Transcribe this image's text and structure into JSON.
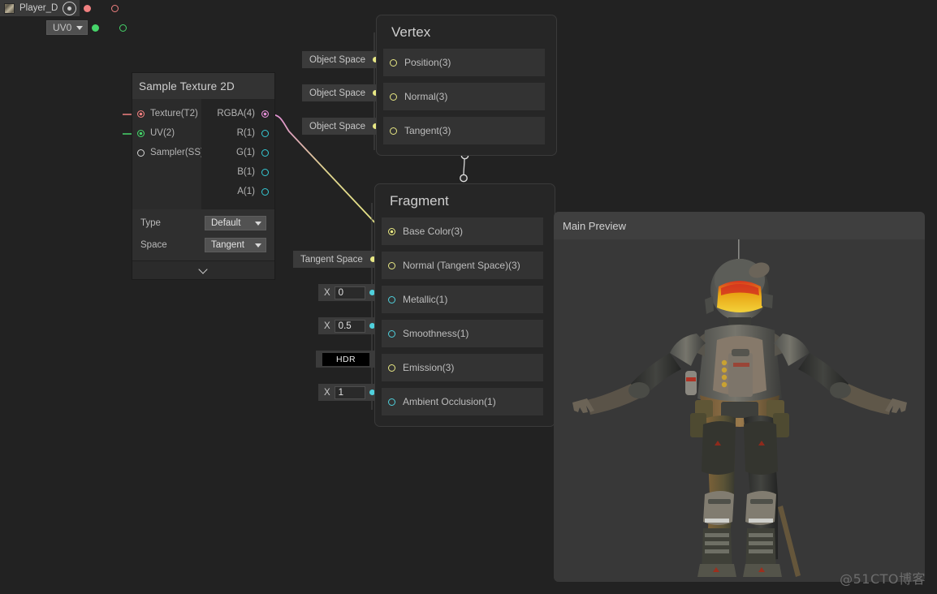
{
  "theme": {
    "background": "#222222",
    "node_body": "#2b2b2b",
    "node_header": "#333333",
    "master_body": "#262626",
    "row_bg": "#333333",
    "wire_vector": "#e8e884",
    "wire_float": "#4fd0dc",
    "wire_rgba": "#e58fd8",
    "wire_texture": "#f08080",
    "wire_uv": "#46d46a",
    "preview_bg": "#383838"
  },
  "property_node": {
    "name": "Player_D",
    "icon": "texture-thumbnail",
    "target_icon": "target-icon",
    "uv_dropdown": {
      "value": "UV0",
      "caret": "chevron-down-icon"
    }
  },
  "sample_texture_node": {
    "title": "Sample Texture 2D",
    "inputs": [
      {
        "label": "Texture(T2)",
        "port": "filled",
        "color": "#f08080",
        "connected": true
      },
      {
        "label": "UV(2)",
        "port": "filled",
        "color": "#46d46a",
        "connected": true
      },
      {
        "label": "Sampler(SS)",
        "port": "hollow",
        "color": "#d6d6d6",
        "connected": false
      }
    ],
    "outputs": [
      {
        "label": "RGBA(4)",
        "port": "filled",
        "color": "#e58fd8",
        "connected": true
      },
      {
        "label": "R(1)",
        "port": "hollow",
        "color": "#35c9d4",
        "connected": false
      },
      {
        "label": "G(1)",
        "port": "hollow",
        "color": "#35c9d4",
        "connected": false
      },
      {
        "label": "B(1)",
        "port": "hollow",
        "color": "#35c9d4",
        "connected": false
      },
      {
        "label": "A(1)",
        "port": "hollow",
        "color": "#35c9d4",
        "connected": false
      }
    ],
    "settings": [
      {
        "label": "Type",
        "value": "Default"
      },
      {
        "label": "Space",
        "value": "Tangent"
      }
    ],
    "expander_icon": "chevron-down-icon"
  },
  "vertex_node": {
    "title": "Vertex",
    "slots": [
      {
        "label": "Position(3)",
        "widget": "Object Space",
        "port_color": "#e8e884",
        "connected": true
      },
      {
        "label": "Normal(3)",
        "widget": "Object Space",
        "port_color": "#e8e884",
        "connected": true
      },
      {
        "label": "Tangent(3)",
        "widget": "Object Space",
        "port_color": "#e8e884",
        "connected": true
      }
    ]
  },
  "fragment_node": {
    "title": "Fragment",
    "slots": [
      {
        "label": "Base Color(3)",
        "widget": null,
        "widget_type": "none",
        "port_color": "#e8e884",
        "connected": true
      },
      {
        "label": "Normal (Tangent Space)(3)",
        "widget": "Tangent Space",
        "widget_type": "dropdown",
        "port_color": "#e8e884",
        "connected": true
      },
      {
        "label": "Metallic(1)",
        "widget": "0",
        "widget_type": "xfield",
        "widget_axis": "X",
        "port_color": "#4fd0dc",
        "connected": true
      },
      {
        "label": "Smoothness(1)",
        "widget": "0.5",
        "widget_type": "xfield",
        "widget_axis": "X",
        "port_color": "#4fd0dc",
        "connected": true
      },
      {
        "label": "Emission(3)",
        "widget": "HDR",
        "widget_type": "hdr",
        "port_color": "#e8e884",
        "connected": true
      },
      {
        "label": "Ambient Occlusion(1)",
        "widget": "1",
        "widget_type": "xfield",
        "widget_axis": "X",
        "port_color": "#4fd0dc",
        "connected": true
      }
    ]
  },
  "preview_panel": {
    "title": "Main Preview",
    "content": "3d-character-render"
  },
  "watermark": "@51CTO博客"
}
